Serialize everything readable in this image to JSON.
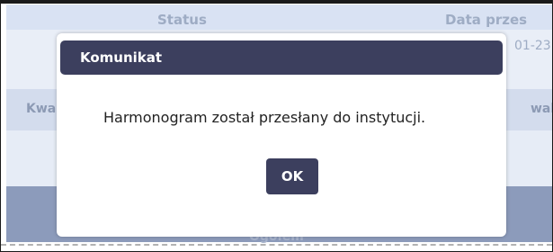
{
  "background_page": {
    "column_status": "Status",
    "column_date": "Data przes",
    "date_value": "01-23",
    "column_left_partial": "Kwa",
    "column_right_partial": "walit",
    "footer_label": "Ogółem"
  },
  "dialog": {
    "title": "Komunikat",
    "message": "Harmonogram został przesłany do instytucji.",
    "ok_label": "OK"
  },
  "colors": {
    "dialog_header": "#3c3f5e",
    "overlay": "#d9e2f3"
  }
}
